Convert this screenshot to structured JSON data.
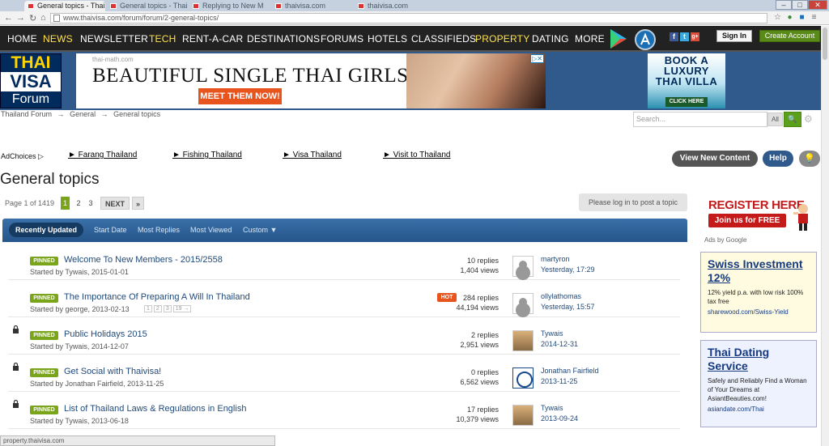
{
  "browser": {
    "tabs": [
      {
        "label": "General topics - Thai"
      },
      {
        "label": "General topics - Thai"
      },
      {
        "label": "Replying to New M"
      },
      {
        "label": "thaivisa.com"
      },
      {
        "label": "thaivisa.com"
      }
    ],
    "window_controls": {
      "minimize": "–",
      "maximize": "□",
      "close": "✕"
    },
    "url": "www.thaivisa.com/forum/forum/2-general-topics/",
    "status_url": "property.thaivisa.com"
  },
  "nav": {
    "items": [
      {
        "label": "HOME",
        "style": "normal"
      },
      {
        "label": "NEWS",
        "style": "yellow"
      },
      {
        "label": "NEWSLETTER",
        "style": "normal"
      },
      {
        "label": "TECH",
        "style": "yellow"
      },
      {
        "label": "RENT-A-CAR",
        "style": "normal"
      },
      {
        "label": "DESTINATIONS",
        "style": "normal"
      },
      {
        "label": "FORUMS",
        "style": "normal"
      },
      {
        "label": "HOTELS",
        "style": "normal"
      },
      {
        "label": "CLASSIFIEDS",
        "style": "normal"
      },
      {
        "label": "PROPERTY",
        "style": "active"
      },
      {
        "label": "DATING",
        "style": "normal"
      },
      {
        "label": "MORE",
        "style": "normal"
      }
    ],
    "signin_label": "Sign In",
    "create_label": "Create Account",
    "social": [
      "f",
      "t",
      "g+"
    ]
  },
  "logo": {
    "line1": "THAI",
    "line2": "VISA",
    "line3": "Forum"
  },
  "ad_banner": {
    "source": "thai-math.com",
    "headline": "BEAUTIFUL SINGLE THAI GIRLS",
    "cta": "MEET THEM NOW!",
    "adx": "▷✕"
  },
  "ad_villa": {
    "line1": "BOOK A",
    "line2": "LUXURY",
    "line3": "THAI VILLA",
    "cta": "CLICK HERE"
  },
  "breadcrumb": {
    "items": [
      "Thailand Forum",
      "General",
      "General topics"
    ],
    "separator": "→"
  },
  "search": {
    "placeholder": "Search...",
    "scope": "All",
    "go": "🔍"
  },
  "adchoices": "AdChoices ▷",
  "adlinks": [
    "► Farang Thailand",
    "► Fishing Thailand",
    "► Visa Thailand",
    "► Visit to Thailand"
  ],
  "actions": {
    "view_new": "View New Content",
    "help": "Help",
    "bulb": "💡"
  },
  "page": {
    "title": "General topics",
    "page_of": "Page 1 of 1419",
    "pages": [
      "1",
      "2",
      "3"
    ],
    "next": "NEXT",
    "last": "»",
    "login_msg": "Please log in to post a topic"
  },
  "filters": {
    "items": [
      "Recently Updated",
      "Start Date",
      "Most Replies",
      "Most Viewed",
      "Custom ▼"
    ],
    "selected_index": 0
  },
  "topics": [
    {
      "locked": false,
      "title": "Welcome To New Members - 2015/2558",
      "started": "Started by Tywais, 2015-01-01",
      "pages": [],
      "hot": false,
      "replies": "10 replies",
      "views": "1,404 views",
      "avatar": "default",
      "last_user": "martyron",
      "last_date": "Yesterday, 17:29"
    },
    {
      "locked": false,
      "title": "The Importance Of Preparing A Will In Thailand",
      "started": "Started by george, 2013-02-13",
      "pages": [
        "1",
        "2",
        "3",
        "19 →"
      ],
      "hot": true,
      "hot_label": "HOT",
      "replies": "284 replies",
      "views": "44,194 views",
      "avatar": "default",
      "last_user": "ollylathomas",
      "last_date": "Yesterday, 15:57"
    },
    {
      "locked": true,
      "title": "Public Holidays 2015",
      "started": "Started by Tywais, 2014-12-07",
      "pages": [],
      "hot": false,
      "replies": "2 replies",
      "views": "2,951 views",
      "avatar": "dog",
      "last_user": "Tywais",
      "last_date": "2014-12-31"
    },
    {
      "locked": true,
      "title": "Get Social with Thaivisa!",
      "started": "Started by Jonathan Fairfield, 2013-11-25",
      "pages": [],
      "hot": false,
      "replies": "0 replies",
      "views": "6,562 views",
      "avatar": "org",
      "last_user": "Jonathan Fairfield",
      "last_date": "2013-11-25"
    },
    {
      "locked": true,
      "title": "List of Thailand Laws & Regulations in English",
      "started": "Started by Tywais, 2013-06-18",
      "pages": [],
      "hot": false,
      "replies": "17 replies",
      "views": "10,379 views",
      "avatar": "dog",
      "last_user": "Tywais",
      "last_date": "2013-09-24"
    }
  ],
  "pinned_label": "PINNED",
  "sidebar": {
    "register": {
      "title": "REGISTER HERE",
      "button": "Join us for FREE"
    },
    "ads_by_google": "Ads by Google",
    "ads": [
      {
        "headline": "Swiss Investment 12%",
        "desc": "12% yield p.a. with low risk 100% tax free",
        "url": "sharewood.com/Swiss-Yield"
      },
      {
        "headline": "Thai Dating Service",
        "desc": "Safely and Reliably Find a Woman of Your Dreams at AsiantBeauties.com!",
        "url": "asiandate.com/Thai"
      }
    ]
  },
  "colors": {
    "nav_bg": "#222222",
    "accent_green": "#7aa51a",
    "brand_blue": "#2f5a8b",
    "hot_orange": "#e8541e"
  }
}
